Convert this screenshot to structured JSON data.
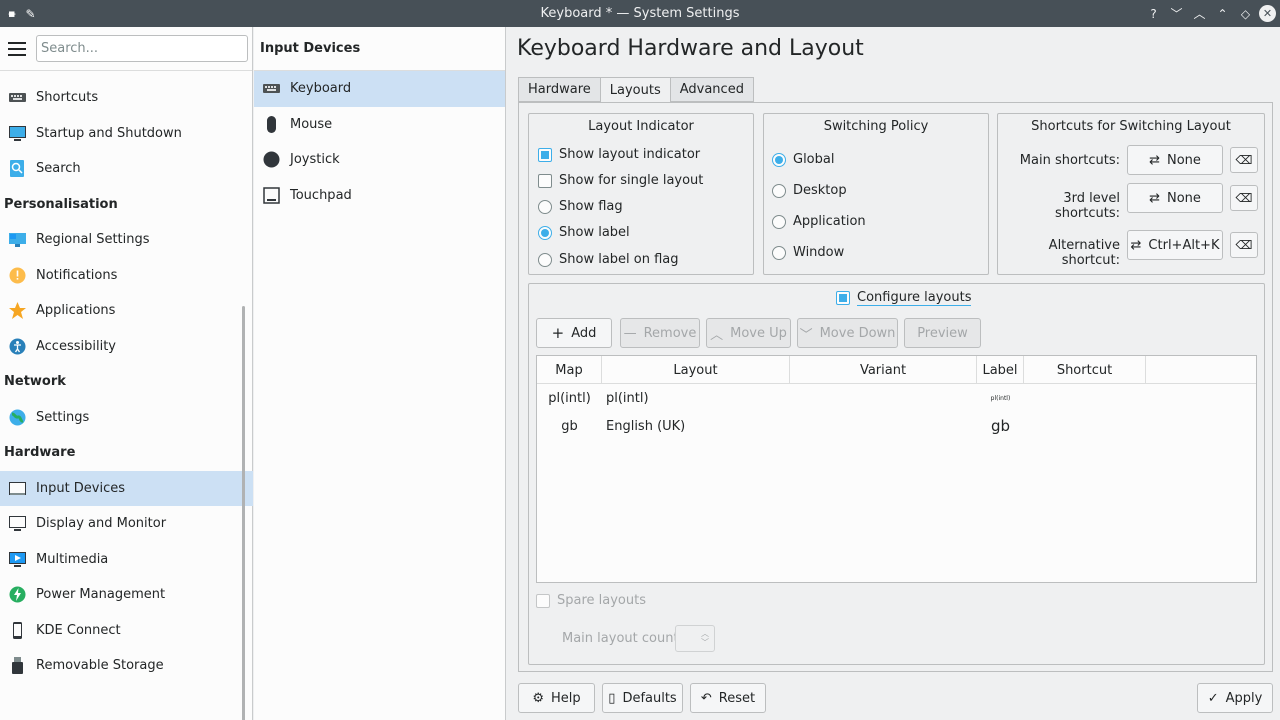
{
  "window": {
    "title": "Keyboard * — System Settings"
  },
  "sidebar": {
    "search_placeholder": "Search...",
    "items": [
      {
        "label": "Shortcuts",
        "icon": "keyboard-icon"
      },
      {
        "label": "Startup and Shutdown",
        "icon": "monitor-icon"
      },
      {
        "label": "Search",
        "icon": "search-icon"
      }
    ],
    "sections": [
      {
        "title": "Personalisation",
        "items": [
          {
            "label": "Regional Settings",
            "icon": "flag-icon"
          },
          {
            "label": "Notifications",
            "icon": "bell-icon"
          },
          {
            "label": "Applications",
            "icon": "star-icon"
          },
          {
            "label": "Accessibility",
            "icon": "accessibility-icon"
          }
        ]
      },
      {
        "title": "Network",
        "items": [
          {
            "label": "Settings",
            "icon": "globe-icon"
          }
        ]
      },
      {
        "title": "Hardware",
        "items": [
          {
            "label": "Input Devices",
            "icon": "keyboard-icon"
          },
          {
            "label": "Display and Monitor",
            "icon": "monitor-icon"
          },
          {
            "label": "Multimedia",
            "icon": "multimedia-icon"
          },
          {
            "label": "Power Management",
            "icon": "power-icon"
          },
          {
            "label": "KDE Connect",
            "icon": "phone-icon"
          },
          {
            "label": "Removable Storage",
            "icon": "usb-icon"
          }
        ]
      }
    ]
  },
  "middle": {
    "title": "Input Devices",
    "items": [
      {
        "label": "Keyboard",
        "icon": "keyboard-icon"
      },
      {
        "label": "Mouse",
        "icon": "mouse-icon"
      },
      {
        "label": "Joystick",
        "icon": "joystick-icon"
      },
      {
        "label": "Touchpad",
        "icon": "touchpad-icon"
      }
    ]
  },
  "main": {
    "title": "Keyboard Hardware and Layout",
    "tabs": [
      "Hardware",
      "Layouts",
      "Advanced"
    ],
    "layout_indicator": {
      "title": "Layout Indicator",
      "show_layout_indicator": "Show layout indicator",
      "show_for_single_layout": "Show for single layout",
      "show_flag": "Show flag",
      "show_label": "Show label",
      "show_label_on_flag": "Show label on flag"
    },
    "switching_policy": {
      "title": "Switching Policy",
      "options": [
        "Global",
        "Desktop",
        "Application",
        "Window"
      ]
    },
    "shortcuts": {
      "title": "Shortcuts for Switching Layout",
      "main_label": "Main shortcuts:",
      "main_value": "None",
      "third_label": "3rd level shortcuts:",
      "third_value": "None",
      "alt_label": "Alternative shortcut:",
      "alt_value": "Ctrl+Alt+K"
    },
    "configure_layouts": "Configure layouts",
    "toolbar": {
      "add": "Add",
      "remove": "Remove",
      "move_up": "Move Up",
      "move_down": "Move Down",
      "preview": "Preview"
    },
    "table": {
      "columns": [
        "Map",
        "Layout",
        "Variant",
        "Label",
        "Shortcut"
      ],
      "rows": [
        {
          "map": "pl(intl)",
          "layout": "pl(intl)",
          "variant": "",
          "label": "pl(intl)",
          "shortcut": ""
        },
        {
          "map": "gb",
          "layout": "English (UK)",
          "variant": "",
          "label": "gb",
          "shortcut": ""
        }
      ]
    },
    "spare_layouts": "Spare layouts",
    "main_layout_count": "Main layout count:"
  },
  "footer": {
    "help": "Help",
    "defaults": "Defaults",
    "reset": "Reset",
    "apply": "Apply"
  }
}
